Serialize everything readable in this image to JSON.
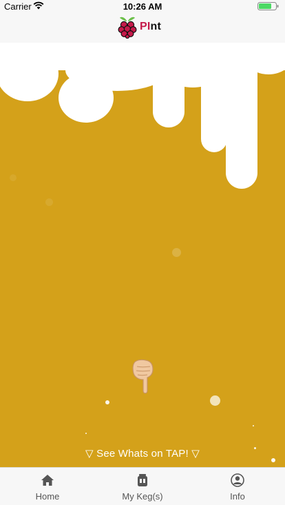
{
  "status_bar": {
    "carrier": "Carrier",
    "time": "10:26 AM"
  },
  "header": {
    "brand_pi": "PI",
    "brand_rest": "nt",
    "logo_icon": "raspberry-pi-icon",
    "brand_color": "#c51a4a"
  },
  "main": {
    "tap_hint": "▽ See Whats on TAP! ▽",
    "hint_icon": "pointing-down-hand-icon",
    "beer_color": "#d4a11a",
    "foam_color": "#ffffff"
  },
  "tabs": [
    {
      "label": "Home",
      "icon": "home-icon"
    },
    {
      "label": "My Keg(s)",
      "icon": "keg-icon"
    },
    {
      "label": "Info",
      "icon": "person-icon"
    }
  ]
}
